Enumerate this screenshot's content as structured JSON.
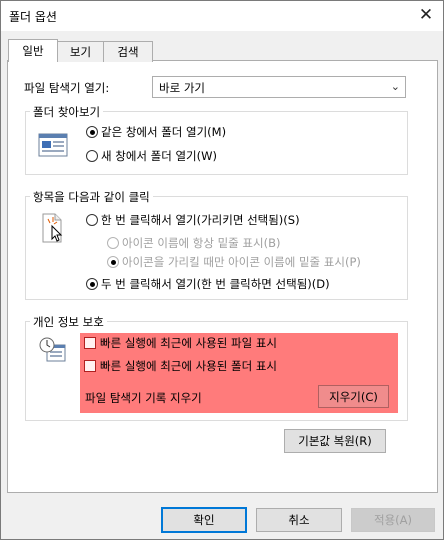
{
  "window": {
    "title": "폴더 옵션",
    "close_glyph": "✕"
  },
  "tabs": [
    {
      "label": "일반",
      "active": true
    },
    {
      "label": "보기",
      "active": false
    },
    {
      "label": "검색",
      "active": false
    }
  ],
  "explorer_open": {
    "label": "파일 탐색기 열기:",
    "value": "바로 가기",
    "arrow": "⌄"
  },
  "browse": {
    "title": "폴더 찾아보기",
    "options": [
      {
        "label": "같은 창에서 폴더 열기(M)",
        "selected": true
      },
      {
        "label": "새 창에서 폴더 열기(W)",
        "selected": false
      }
    ]
  },
  "click": {
    "title": "항목을 다음과 같이 클릭",
    "single": "한 번 클릭해서 열기(가리키면 선택됨)(S)",
    "underline_always": "아이콘 이름에 항상 밑줄 표시(B)",
    "underline_point": "아이콘을 가리킬 때만 아이콘 이름에 밑줄 표시(P)",
    "double": "두 번 클릭해서 열기(한 번 클릭하면 선택됨)(D)"
  },
  "privacy": {
    "title": "개인 정보 보호",
    "recent_files": "빠른 실행에 최근에 사용된 파일 표시",
    "recent_folders": "빠른 실행에 최근에 사용된 폴더 표시",
    "clear_label": "파일 탐색기 기록 지우기",
    "clear_button": "지우기(C)"
  },
  "restore_button": "기본값 복원(R)",
  "footer": {
    "ok": "확인",
    "cancel": "취소",
    "apply": "적용(A)"
  },
  "colors": {
    "highlight": "#ff7b7b",
    "focus_border": "#0078d7"
  }
}
